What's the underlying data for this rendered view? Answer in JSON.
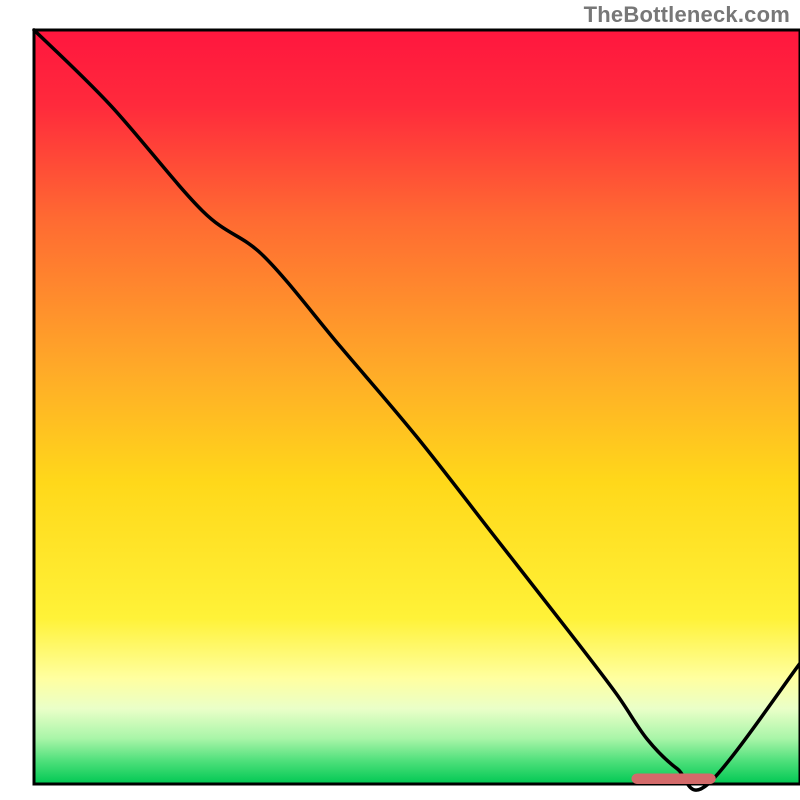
{
  "attribution": "TheBottleneck.com",
  "chart_data": {
    "type": "line",
    "title": "",
    "xlabel": "",
    "ylabel": "",
    "xlim": [
      0,
      100
    ],
    "ylim": [
      0,
      100
    ],
    "grid": false,
    "background_gradient": {
      "stops": [
        {
          "offset": 0.0,
          "color": "#ff163e"
        },
        {
          "offset": 0.1,
          "color": "#ff2a3c"
        },
        {
          "offset": 0.25,
          "color": "#ff6a32"
        },
        {
          "offset": 0.45,
          "color": "#ffaa28"
        },
        {
          "offset": 0.6,
          "color": "#ffd81a"
        },
        {
          "offset": 0.78,
          "color": "#fff238"
        },
        {
          "offset": 0.86,
          "color": "#ffffa0"
        },
        {
          "offset": 0.9,
          "color": "#eaffc8"
        },
        {
          "offset": 0.94,
          "color": "#a8f5a8"
        },
        {
          "offset": 0.97,
          "color": "#4ddf7a"
        },
        {
          "offset": 1.0,
          "color": "#00c853"
        }
      ]
    },
    "series": [
      {
        "name": "bottleneck-curve",
        "stroke": "#000000",
        "stroke_width": 3.5,
        "x": [
          0,
          10,
          22,
          30,
          40,
          50,
          60,
          70,
          76,
          80,
          84,
          88,
          100
        ],
        "y": [
          100,
          90,
          76,
          70,
          58,
          46,
          33,
          20,
          12,
          6,
          2,
          0,
          16
        ]
      }
    ],
    "marker": {
      "name": "optimal-zone-marker",
      "color": "#d36a6a",
      "x_start": 78,
      "x_end": 89,
      "y": 0.7,
      "height": 1.4
    }
  }
}
